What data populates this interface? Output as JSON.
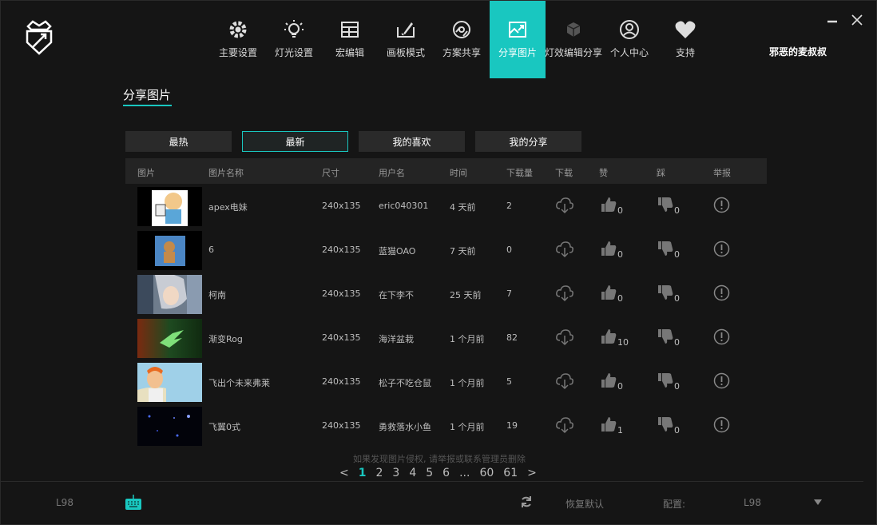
{
  "nav": {
    "items": [
      {
        "label": "主要设置",
        "icon": "gear-icon"
      },
      {
        "label": "灯光设置",
        "icon": "bulb-icon"
      },
      {
        "label": "宏编辑",
        "icon": "grid-icon"
      },
      {
        "label": "画板模式",
        "icon": "paint-icon"
      },
      {
        "label": "方案共享",
        "icon": "disc-icon"
      },
      {
        "label": "分享图片",
        "icon": "image-share-icon"
      },
      {
        "label": "灯效编辑分享",
        "icon": "cube-icon"
      },
      {
        "label": "个人中心",
        "icon": "user-icon"
      },
      {
        "label": "支持",
        "icon": "heart-icon"
      }
    ],
    "active_index": 5,
    "username": "邪恶的麦叔叔"
  },
  "page_title": "分享图片",
  "filter_tabs": [
    "最热",
    "最新",
    "我的喜欢",
    "我的分享"
  ],
  "active_filter": 1,
  "table": {
    "headers": [
      "图片",
      "图片名称",
      "尺寸",
      "用户名",
      "时间",
      "下载量",
      "下载",
      "赞",
      "踩",
      "举报"
    ],
    "rows": [
      {
        "name": "apex电妹",
        "size": "240x135",
        "user": "eric040301",
        "time": "4 天前",
        "downloads": "2",
        "likes": "0",
        "dislikes": "0"
      },
      {
        "name": "6",
        "size": "240x135",
        "user": "蓝猫OAO",
        "time": "7 天前",
        "downloads": "0",
        "likes": "0",
        "dislikes": "0"
      },
      {
        "name": "柯南",
        "size": "240x135",
        "user": "在下李不",
        "time": "25 天前",
        "downloads": "7",
        "likes": "0",
        "dislikes": "0"
      },
      {
        "name": "渐变Rog",
        "size": "240x135",
        "user": "海洋盆栽",
        "time": "1 个月前",
        "downloads": "82",
        "likes": "10",
        "dislikes": "0"
      },
      {
        "name": "飞出个未来弗莱",
        "size": "240x135",
        "user": "松子不吃仓鼠",
        "time": "1 个月前",
        "downloads": "5",
        "likes": "0",
        "dislikes": "0"
      },
      {
        "name": "飞翼0式",
        "size": "240x135",
        "user": "勇救落水小鱼",
        "time": "1 个月前",
        "downloads": "19",
        "likes": "1",
        "dislikes": "0"
      }
    ]
  },
  "notice": "如果发现图片侵权, 请举报或联系管理员删除",
  "pagination": {
    "prev": "<",
    "pages": [
      "1",
      "2",
      "3",
      "4",
      "5",
      "6",
      "...",
      "60",
      "61"
    ],
    "current": "1",
    "next": ">"
  },
  "bottom": {
    "device": "L98",
    "reset_label": "恢复默认",
    "config_label": "配置:",
    "config_value": "L98"
  },
  "colors": {
    "accent": "#19c7c0",
    "background": "#151515"
  }
}
